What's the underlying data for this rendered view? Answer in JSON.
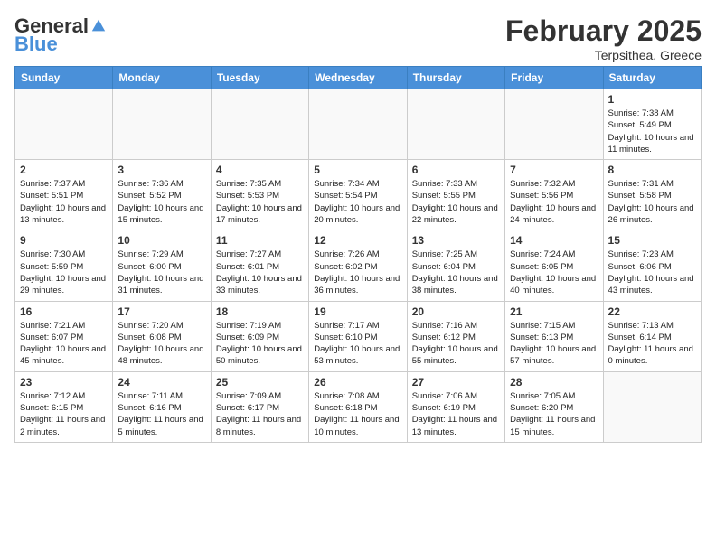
{
  "header": {
    "logo_general": "General",
    "logo_blue": "Blue",
    "month_title": "February 2025",
    "location": "Terpsithea, Greece"
  },
  "days_of_week": [
    "Sunday",
    "Monday",
    "Tuesday",
    "Wednesday",
    "Thursday",
    "Friday",
    "Saturday"
  ],
  "weeks": [
    [
      {
        "day": "",
        "info": ""
      },
      {
        "day": "",
        "info": ""
      },
      {
        "day": "",
        "info": ""
      },
      {
        "day": "",
        "info": ""
      },
      {
        "day": "",
        "info": ""
      },
      {
        "day": "",
        "info": ""
      },
      {
        "day": "1",
        "info": "Sunrise: 7:38 AM\nSunset: 5:49 PM\nDaylight: 10 hours\nand 11 minutes."
      }
    ],
    [
      {
        "day": "2",
        "info": "Sunrise: 7:37 AM\nSunset: 5:51 PM\nDaylight: 10 hours\nand 13 minutes."
      },
      {
        "day": "3",
        "info": "Sunrise: 7:36 AM\nSunset: 5:52 PM\nDaylight: 10 hours\nand 15 minutes."
      },
      {
        "day": "4",
        "info": "Sunrise: 7:35 AM\nSunset: 5:53 PM\nDaylight: 10 hours\nand 17 minutes."
      },
      {
        "day": "5",
        "info": "Sunrise: 7:34 AM\nSunset: 5:54 PM\nDaylight: 10 hours\nand 20 minutes."
      },
      {
        "day": "6",
        "info": "Sunrise: 7:33 AM\nSunset: 5:55 PM\nDaylight: 10 hours\nand 22 minutes."
      },
      {
        "day": "7",
        "info": "Sunrise: 7:32 AM\nSunset: 5:56 PM\nDaylight: 10 hours\nand 24 minutes."
      },
      {
        "day": "8",
        "info": "Sunrise: 7:31 AM\nSunset: 5:58 PM\nDaylight: 10 hours\nand 26 minutes."
      }
    ],
    [
      {
        "day": "9",
        "info": "Sunrise: 7:30 AM\nSunset: 5:59 PM\nDaylight: 10 hours\nand 29 minutes."
      },
      {
        "day": "10",
        "info": "Sunrise: 7:29 AM\nSunset: 6:00 PM\nDaylight: 10 hours\nand 31 minutes."
      },
      {
        "day": "11",
        "info": "Sunrise: 7:27 AM\nSunset: 6:01 PM\nDaylight: 10 hours\nand 33 minutes."
      },
      {
        "day": "12",
        "info": "Sunrise: 7:26 AM\nSunset: 6:02 PM\nDaylight: 10 hours\nand 36 minutes."
      },
      {
        "day": "13",
        "info": "Sunrise: 7:25 AM\nSunset: 6:04 PM\nDaylight: 10 hours\nand 38 minutes."
      },
      {
        "day": "14",
        "info": "Sunrise: 7:24 AM\nSunset: 6:05 PM\nDaylight: 10 hours\nand 40 minutes."
      },
      {
        "day": "15",
        "info": "Sunrise: 7:23 AM\nSunset: 6:06 PM\nDaylight: 10 hours\nand 43 minutes."
      }
    ],
    [
      {
        "day": "16",
        "info": "Sunrise: 7:21 AM\nSunset: 6:07 PM\nDaylight: 10 hours\nand 45 minutes."
      },
      {
        "day": "17",
        "info": "Sunrise: 7:20 AM\nSunset: 6:08 PM\nDaylight: 10 hours\nand 48 minutes."
      },
      {
        "day": "18",
        "info": "Sunrise: 7:19 AM\nSunset: 6:09 PM\nDaylight: 10 hours\nand 50 minutes."
      },
      {
        "day": "19",
        "info": "Sunrise: 7:17 AM\nSunset: 6:10 PM\nDaylight: 10 hours\nand 53 minutes."
      },
      {
        "day": "20",
        "info": "Sunrise: 7:16 AM\nSunset: 6:12 PM\nDaylight: 10 hours\nand 55 minutes."
      },
      {
        "day": "21",
        "info": "Sunrise: 7:15 AM\nSunset: 6:13 PM\nDaylight: 10 hours\nand 57 minutes."
      },
      {
        "day": "22",
        "info": "Sunrise: 7:13 AM\nSunset: 6:14 PM\nDaylight: 11 hours\nand 0 minutes."
      }
    ],
    [
      {
        "day": "23",
        "info": "Sunrise: 7:12 AM\nSunset: 6:15 PM\nDaylight: 11 hours\nand 2 minutes."
      },
      {
        "day": "24",
        "info": "Sunrise: 7:11 AM\nSunset: 6:16 PM\nDaylight: 11 hours\nand 5 minutes."
      },
      {
        "day": "25",
        "info": "Sunrise: 7:09 AM\nSunset: 6:17 PM\nDaylight: 11 hours\nand 8 minutes."
      },
      {
        "day": "26",
        "info": "Sunrise: 7:08 AM\nSunset: 6:18 PM\nDaylight: 11 hours\nand 10 minutes."
      },
      {
        "day": "27",
        "info": "Sunrise: 7:06 AM\nSunset: 6:19 PM\nDaylight: 11 hours\nand 13 minutes."
      },
      {
        "day": "28",
        "info": "Sunrise: 7:05 AM\nSunset: 6:20 PM\nDaylight: 11 hours\nand 15 minutes."
      },
      {
        "day": "",
        "info": ""
      }
    ]
  ]
}
